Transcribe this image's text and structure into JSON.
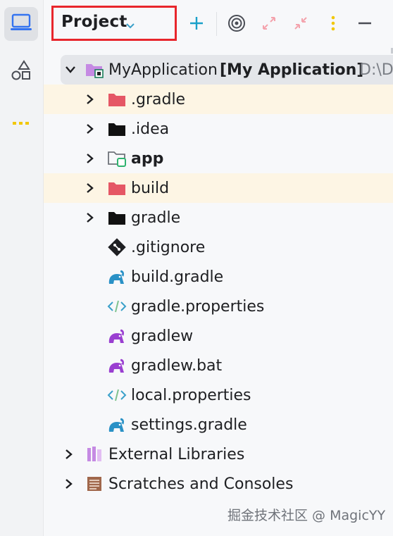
{
  "toolbar": {
    "view_title": "Project",
    "view_dropdown_icon": "chevron-down-icon",
    "add_icon": "plus-icon",
    "locate_icon": "target-icon",
    "expand_icon": "expand-all-icon",
    "collapse_icon": "collapse-all-icon",
    "options_icon": "kebab-menu-icon",
    "hide_icon": "minus-icon",
    "highlight_color": "#e8262c"
  },
  "left_strip": {
    "items": [
      {
        "name": "project-view-icon",
        "active": true
      },
      {
        "name": "structure-shapes-icon",
        "active": false
      },
      {
        "name": "more-tools-icon",
        "active": false
      }
    ]
  },
  "tree": {
    "root": {
      "name": "MyApplication",
      "module": "[My Application]",
      "path": "D:\\D"
    },
    "items": [
      {
        "label": ".gradle",
        "icon": "excluded-folder-icon"
      },
      {
        "label": ".idea",
        "icon": "folder-icon"
      },
      {
        "label": "app",
        "icon": "module-folder-icon"
      },
      {
        "label": "build",
        "icon": "excluded-folder-icon"
      },
      {
        "label": "gradle",
        "icon": "folder-icon"
      },
      {
        "label": ".gitignore",
        "icon": "git-file-icon"
      },
      {
        "label": "build.gradle",
        "icon": "gradle-elephant-icon"
      },
      {
        "label": "gradle.properties",
        "icon": "properties-file-icon"
      },
      {
        "label": "gradlew",
        "icon": "gradle-script-icon"
      },
      {
        "label": "gradlew.bat",
        "icon": "gradle-script-icon"
      },
      {
        "label": "local.properties",
        "icon": "properties-file-icon"
      },
      {
        "label": "settings.gradle",
        "icon": "gradle-elephant-icon"
      }
    ],
    "external_libraries": "External Libraries",
    "scratches": "Scratches and Consoles"
  },
  "watermark": "掘金技术社区 @ MagicYY"
}
